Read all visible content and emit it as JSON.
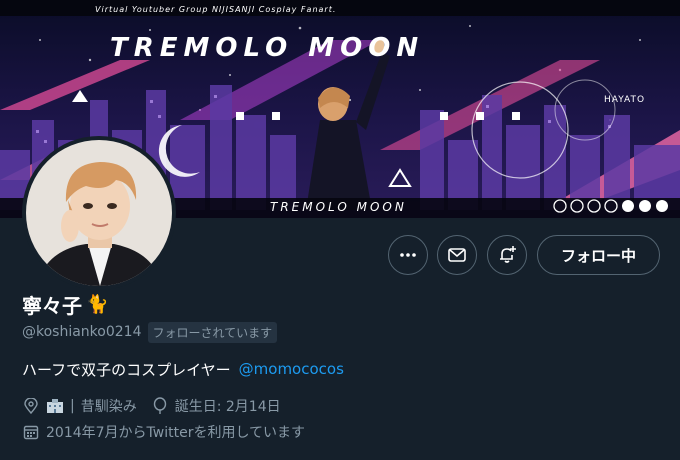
{
  "banner": {
    "tagline": "Virtual Youtuber Group NIJISANJI Cosplay Fanart.",
    "title": "TREMOLO MOON",
    "subtitle": "TREMOLO MOON",
    "side_label": "HAYATO"
  },
  "actions": {
    "more_icon": "more-icon",
    "message_icon": "mail-icon",
    "notify_icon": "bell-plus-icon",
    "follow_label": "フォロー中"
  },
  "profile": {
    "display_name": "寧々子",
    "name_emoji": "🐈",
    "handle": "@koshianko0214",
    "follows_you": "フォローされています",
    "bio_text": "ハーフで双子のコスプレイヤー",
    "bio_mention": "@momococos",
    "location": "昔馴染み",
    "birthday": "誕生日: 2月14日",
    "joined": "2014年7月からTwitterを利用しています"
  },
  "colors": {
    "background": "#15202b",
    "secondary_text": "#8899a6",
    "link": "#1d9bf0",
    "button_border": "#536471"
  }
}
